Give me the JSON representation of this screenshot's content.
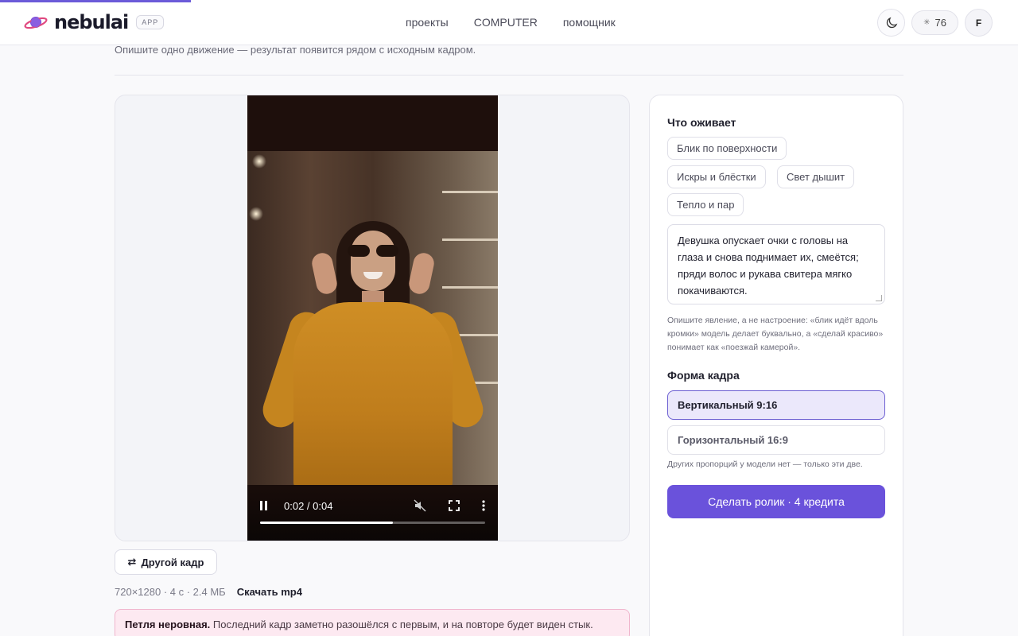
{
  "header": {
    "logo_text": "nebulai",
    "app_badge": "APP",
    "nav": [
      "проекты",
      "COMPUTER",
      "помощник"
    ],
    "credits": "76",
    "avatar_initial": "F",
    "accent_color": "#6a52db"
  },
  "page": {
    "subtitle": "Опишите одно движение — результат появится рядом с исходным кадром."
  },
  "player": {
    "time": "0:02 / 0:04",
    "progress": 0.59
  },
  "below": {
    "other_frame": "Другой кадр",
    "meta": "720×1280 · 4 с · 2.4 МБ",
    "download": "Скачать mp4",
    "warning_title": "Петля неровная.",
    "warning_text": "Последний кадр заметно разошёлся с первым, и на повторе будет виден стык."
  },
  "panel": {
    "section_title": "Что оживает",
    "chips": [
      "Блик по поверхности",
      "Искры и блёстки",
      "Свет дышит",
      "Тепло и пар"
    ],
    "prompt": "Девушка опускает очки с головы на глаза и снова поднимает их, смеётся; пряди волос и рукава свитера мягко покачиваются.",
    "hint": "Опишите явление, а не настроение: «блик идёт вдоль кромки» модель делает буквально, а «сделай красиво» понимает как «поезжай камерой».",
    "format_title": "Форма кадра",
    "formats": [
      "Вертикальный 9:16",
      "Горизонтальный 16:9"
    ],
    "format_note": "Других пропорций у модели нет — только эти две.",
    "submit": "Сделать ролик · 4 кредита"
  }
}
